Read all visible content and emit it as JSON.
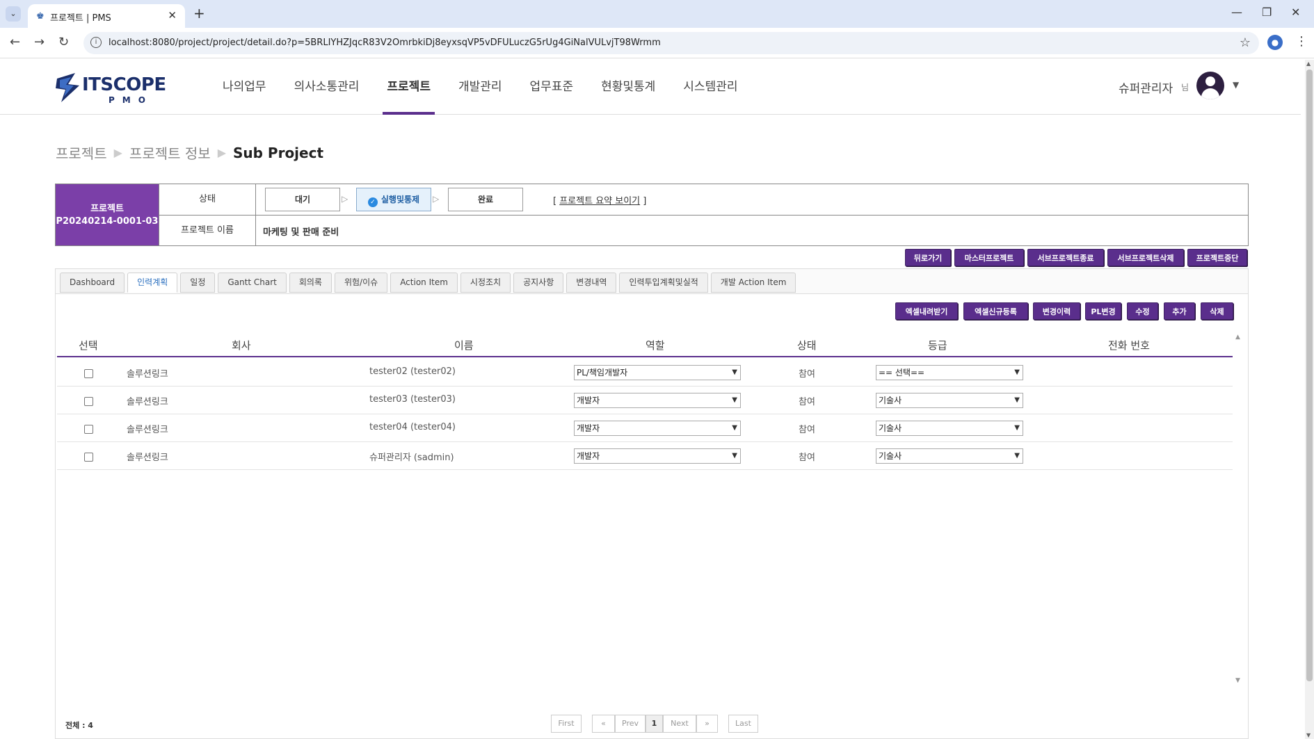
{
  "browser": {
    "tab_title": "프로젝트 | PMS",
    "url": "localhost:8080/project/project/detail.do?p=5BRLIYHZJqcR83V2OmrbkiDj8eyxsqVP5vDFULuczG5rUg4GiNalVULvjT98Wrmm"
  },
  "header": {
    "logo_text": "ITSCOPE",
    "logo_sub": "PMO",
    "nav": [
      "나의업무",
      "의사소통관리",
      "프로젝트",
      "개발관리",
      "업무표준",
      "현황및통계",
      "시스템관리"
    ],
    "active_nav": "프로젝트",
    "user_name": "슈퍼관리자",
    "user_suffix": "님"
  },
  "breadcrumb": [
    "프로젝트",
    "프로젝트 정보",
    "Sub Project"
  ],
  "project": {
    "label": "프로젝트",
    "id": "P20240214-0001-03",
    "status_label": "상태",
    "steps": [
      "대기",
      "실행및통제",
      "완료"
    ],
    "active_step": "실행및통제",
    "summary_link": "프로젝트 요약 보이기",
    "name_label": "프로젝트 이름",
    "name_value": "마케팅 및 판매 준비"
  },
  "action_buttons": [
    "뒤로가기",
    "마스터프로젝트",
    "서브프로젝트종료",
    "서브프로젝트삭제",
    "프로젝트중단"
  ],
  "tabs": [
    "Dashboard",
    "인력계획",
    "일정",
    "Gantt Chart",
    "회의록",
    "위험/이슈",
    "Action Item",
    "시정조치",
    "공지사항",
    "변경내역",
    "인력투입계획및실적",
    "개발 Action Item"
  ],
  "active_tab": "인력계획",
  "grid_buttons": [
    "엑셀내려받기",
    "엑셀신규등록",
    "변경이력",
    "PL변경",
    "수정",
    "추가",
    "삭제"
  ],
  "table": {
    "columns": [
      "선택",
      "회사",
      "이름",
      "역할",
      "상태",
      "등급",
      "전화 번호"
    ],
    "rows": [
      {
        "company": "솔루션링크",
        "name": "tester02 (tester02)",
        "role": "PL/책임개발자",
        "status": "참여",
        "grade": "== 선택==",
        "phone": ""
      },
      {
        "company": "솔루션링크",
        "name": "tester03 (tester03)",
        "role": "개발자",
        "status": "참여",
        "grade": "기술사",
        "phone": ""
      },
      {
        "company": "솔루션링크",
        "name": "tester04 (tester04)",
        "role": "개발자",
        "status": "참여",
        "grade": "기술사",
        "phone": ""
      },
      {
        "company": "솔루션링크",
        "name": "슈퍼관리자 (sadmin)",
        "role": "개발자",
        "status": "참여",
        "grade": "기술사",
        "phone": ""
      }
    ]
  },
  "footer": {
    "total": "전체 : 4",
    "pagination": [
      "First",
      "«",
      "Prev",
      "1",
      "Next",
      "»",
      "Last"
    ],
    "current_page": "1"
  },
  "colors": {
    "accent": "#5a2e8c",
    "project_id_bg": "#7b3fa8",
    "active_tab_text": "#2a6fbf"
  }
}
